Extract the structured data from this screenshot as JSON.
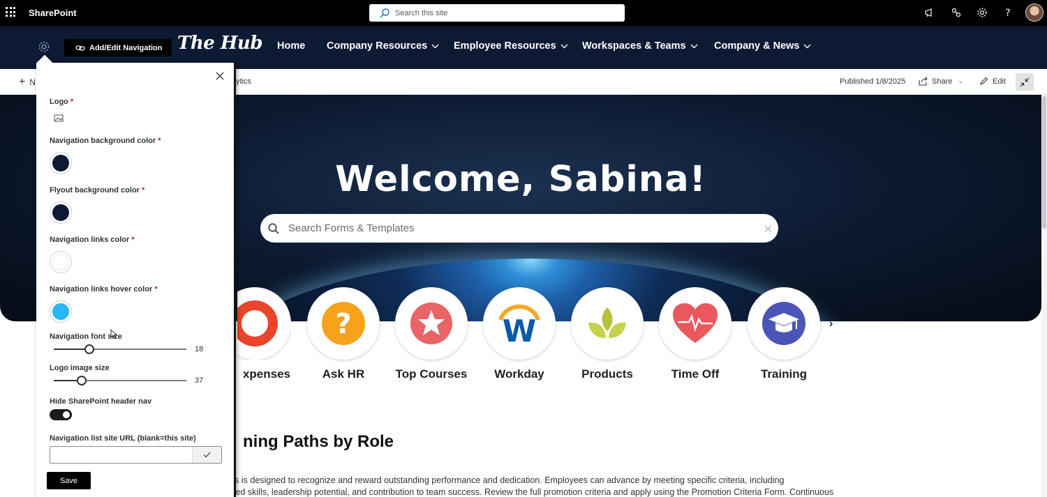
{
  "suitebar": {
    "app_name": "SharePoint",
    "search_placeholder": "Search this site"
  },
  "hubnav": {
    "add_edit_label": "Add/Edit Navigation",
    "logo_text": "The Hub",
    "links": [
      "Home",
      "Company Resources",
      "Employee Resources",
      "Workspaces & Teams",
      "Company & News"
    ]
  },
  "commandbar": {
    "new_label": "N",
    "analytics_label": "ytics",
    "published": "Published 1/8/2025",
    "share_label": "Share",
    "edit_label": "Edit"
  },
  "hero": {
    "welcome": "Welcome, Sabina!",
    "search_placeholder": "Search Forms & Templates"
  },
  "quicklinks": [
    {
      "label": "xpenses",
      "icon": "expenses-icon"
    },
    {
      "label": "Ask HR",
      "icon": "question-icon"
    },
    {
      "label": "Top Courses",
      "icon": "star-icon"
    },
    {
      "label": "Workday",
      "icon": "workday-icon"
    },
    {
      "label": "Products",
      "icon": "leaves-icon"
    },
    {
      "label": "Time Off",
      "icon": "heart-icon"
    },
    {
      "label": "Training",
      "icon": "graduation-cap-icon"
    }
  ],
  "learning": {
    "title": "ning Paths by Role",
    "line1": "tion process is designed to recognize and reward outstanding performance and dedication. Employees can advance by meeting specific criteria, including",
    "line2": "demonstrated skills, leadership potential, and contribution to team success. Review the full promotion criteria and apply using the Promotion Criteria Form. Continuous"
  },
  "panel": {
    "logo_label": "Logo",
    "nav_bg_label": "Navigation background color",
    "flyout_bg_label": "Flyout background color",
    "links_color_label": "Navigation links color",
    "hover_color_label": "Navigation links hover color",
    "font_size_label": "Navigation font size",
    "font_size_value": "18",
    "logo_size_label": "Logo image size",
    "logo_size_value": "37",
    "hide_header_label": "Hide SharePoint header nav",
    "url_label": "Navigation list site URL (blank=this site)",
    "url_value": "",
    "save_label": "Save",
    "required_mark": "*",
    "colors": {
      "nav_bg": "#0d1a33",
      "flyout_bg": "#0d1a33",
      "links": "#ffffff",
      "hover": "#29b6f6"
    },
    "font_size_fraction": 0.27,
    "logo_size_fraction": 0.21,
    "hide_header_on": true
  }
}
